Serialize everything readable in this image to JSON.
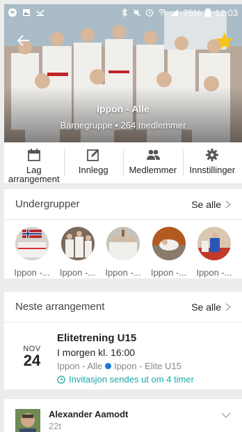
{
  "status_bar": {
    "battery": "75%",
    "time": "12:03"
  },
  "group": {
    "title": "Ippon - Alle",
    "subtitle_type": "Barnegruppe",
    "subtitle_members": "264 medlemmer"
  },
  "actions": [
    {
      "label": "Lag arrangement",
      "icon": "calendar-icon"
    },
    {
      "label": "Innlegg",
      "icon": "edit-icon"
    },
    {
      "label": "Medlemmer",
      "icon": "people-icon"
    },
    {
      "label": "Innstillinger",
      "icon": "gear-icon"
    }
  ],
  "subgroups": {
    "title": "Undergrupper",
    "see_all": "Se alle",
    "items": [
      {
        "label": "Ippon -..."
      },
      {
        "label": "Ippon -..."
      },
      {
        "label": "Ippon -..."
      },
      {
        "label": "Ippon -..."
      },
      {
        "label": "Ippon -..."
      }
    ]
  },
  "next_event": {
    "title": "Neste arrangement",
    "see_all": "Se alle",
    "month": "NOV",
    "day": "24",
    "event_title": "Elitetrening U15",
    "when": "I morgen kl. 16:00",
    "group_from": "Ippon - Alle",
    "group_to": "Ippon - Elite U15",
    "invite": "Invitasjon sendes ut om 4 timer"
  },
  "post": {
    "author": "Alexander Aamodt",
    "time": "22t"
  },
  "colors": {
    "accent_teal": "#1aa9a9",
    "dot_blue": "#1a7bd4",
    "star_yellow": "#f5c518"
  }
}
